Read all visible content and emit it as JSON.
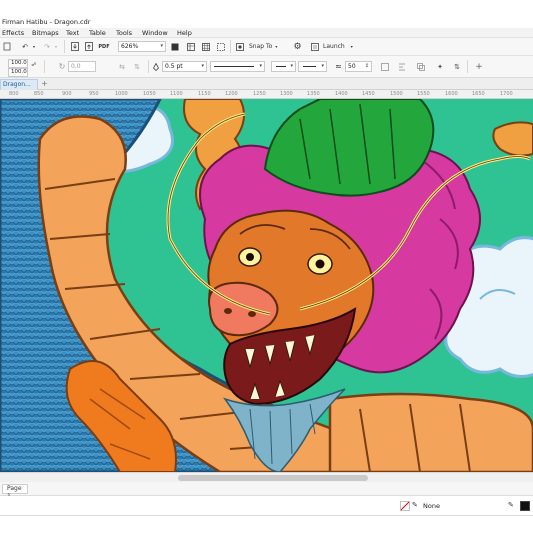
{
  "window": {
    "title": "Firman Hatibu - Dragon.cdr"
  },
  "menu": [
    "Effects",
    "Bitmaps",
    "Text",
    "Table",
    "Tools",
    "Window",
    "Help"
  ],
  "toolbar": {
    "zoom_value": "626%",
    "snap_to_label": "Snap To",
    "launch_label": "Launch"
  },
  "property_bar": {
    "scale_x": "100.0",
    "scale_y": "100.0",
    "rotation": "0.0",
    "outline_width": "0.5 pt",
    "opacity_value": "50"
  },
  "tabs": {
    "document_tab": "Dragon...",
    "add_tab_label": "+"
  },
  "ruler": {
    "ticks": [
      "800",
      "850",
      "900",
      "950",
      "1000",
      "1050",
      "1100",
      "1150",
      "1200",
      "1250",
      "1300",
      "1350",
      "1400",
      "1450",
      "1500",
      "1550",
      "1600",
      "1650",
      "1700"
    ]
  },
  "page_nav": {
    "page_label": "Page 1"
  },
  "status": {
    "fill_label": "None"
  },
  "colors": {
    "background_green": "#2fc394",
    "dragon_scales_blue": "#3a8fc4",
    "dragon_belly_orange": "#f3a35a",
    "mane_magenta": "#d63aa0",
    "horn_green": "#23a63b",
    "cloud_white": "#f2f8fd"
  }
}
